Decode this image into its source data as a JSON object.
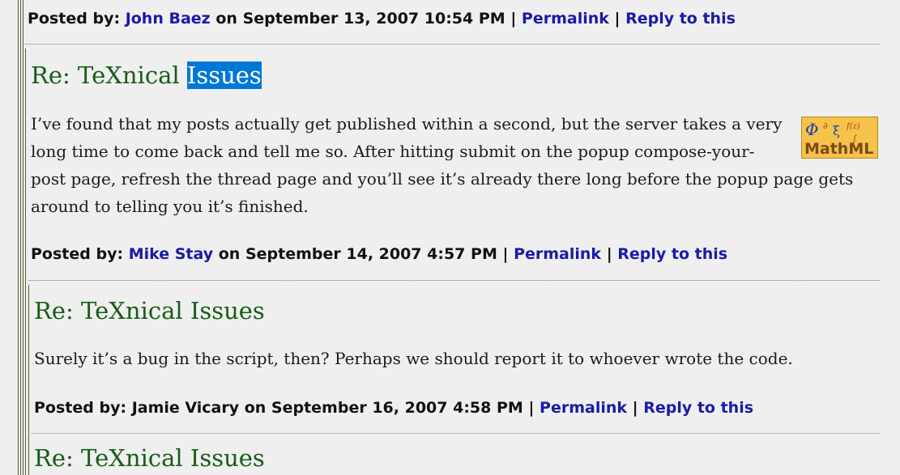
{
  "comments": [
    {
      "posted_label": "Posted by:",
      "author": "John Baez",
      "on_label": "on",
      "date": "September 13, 2007 10:54 PM",
      "sep": "|",
      "permalink": "Permalink",
      "reply": "Reply to this"
    },
    {
      "title_prefix": "Re: TeXnical ",
      "title_selected": "Issues",
      "body_lines": [
        "I’ve found that my posts actually get published within a second, but the server takes a very",
        "long time to come back and tell me so. After hitting submit on the popup compose-your-",
        "post page, refresh the thread page and you’ll see it’s already there long before the popup page gets",
        "around to telling you it’s finished."
      ],
      "badge_text": "MathML",
      "posted_label": "Posted by:",
      "author": "Mike Stay",
      "on_label": "on",
      "date": "September 14, 2007 4:57 PM",
      "sep": "|",
      "permalink": "Permalink",
      "reply": "Reply to this"
    },
    {
      "title": "Re: TeXnical Issues",
      "body": "Surely it’s a bug in the script, then? Perhaps we should report it to whoever wrote the code.",
      "posted_label": "Posted by:",
      "author": "Jamie Vicary on September 16, 2007 4:58 PM",
      "sep": "|",
      "permalink": "Permalink",
      "reply": "Reply to this"
    },
    {
      "title": "Re: TeXnical Issues"
    }
  ]
}
